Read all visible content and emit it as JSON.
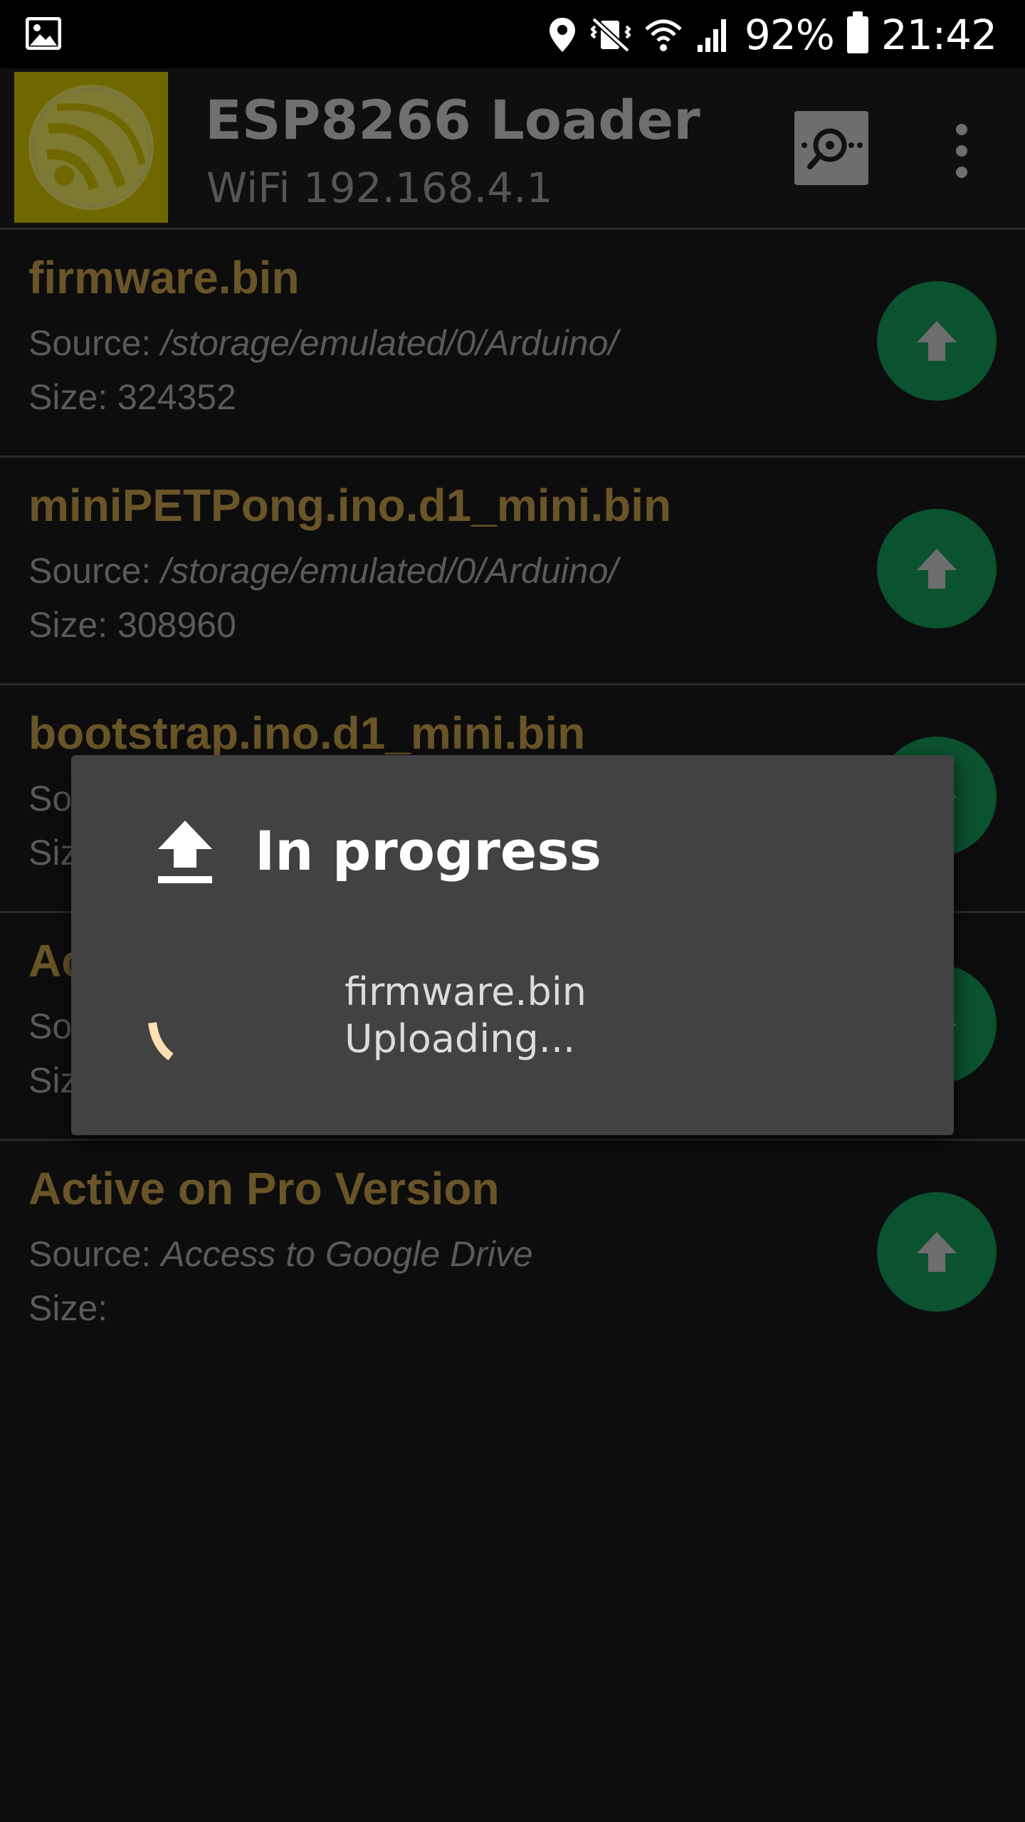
{
  "status_bar": {
    "battery_percent": "92%",
    "time": "21:42",
    "icons": [
      "image-icon",
      "location-icon",
      "vibrate-mute-icon",
      "wifi-icon",
      "signal-icon",
      "battery-icon"
    ]
  },
  "app_bar": {
    "title": "ESP8266 Loader",
    "subtitle": "WiFi 192.168.4.1",
    "logo_color": "#6f6700",
    "actions": [
      "search-device-icon",
      "more-vert-icon"
    ]
  },
  "files": [
    {
      "name": "firmware.bin",
      "source_label": "Source: ",
      "source_path": "/storage/emulated/0/Arduino/",
      "size_label": "Size: 324352"
    },
    {
      "name": "miniPETPong.ino.d1_mini.bin",
      "source_label": "Source: ",
      "source_path": "/storage/emulated/0/Arduino/",
      "size_label": "Size: 308960"
    },
    {
      "name": "bootstrap.ino.d1_mini.bin",
      "source_label": "So",
      "source_path": "",
      "size_label": "Siz"
    },
    {
      "name": "Ac",
      "source_label": "So",
      "source_path": "",
      "size_label": "Siz"
    },
    {
      "name": "Active on Pro Version",
      "source_label": "Source: ",
      "source_path": "Access to Google Drive",
      "size_label": "Size:"
    }
  ],
  "colors": {
    "file_name": "#6a5528",
    "upload_fab": "#0b5230",
    "dialog_bg": "#424242",
    "spinner": "#ffe0b0"
  },
  "dialog": {
    "title": "In progress",
    "file": "firmware.bin",
    "status": "Uploading..."
  }
}
